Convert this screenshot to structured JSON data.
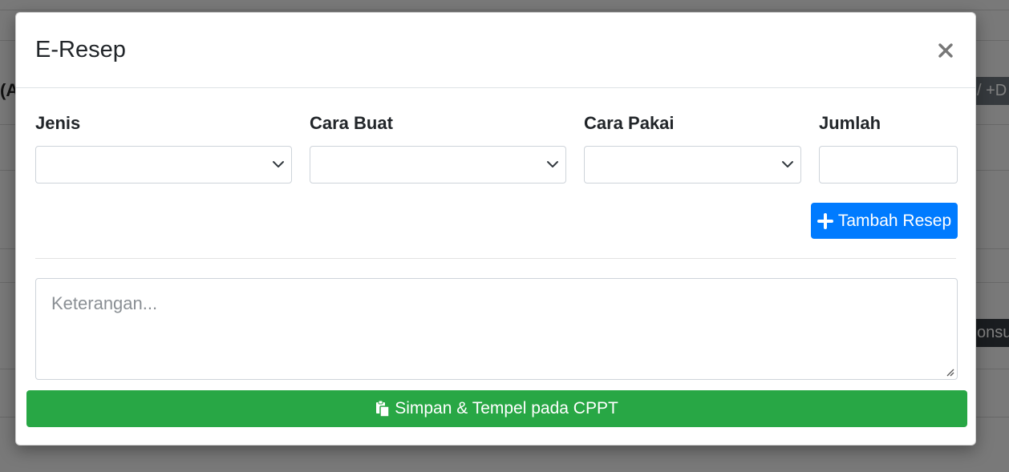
{
  "background": {
    "fragment_left": "(A",
    "fragment_right_top": "/ +D",
    "fragment_right_mid": "onsul"
  },
  "modal": {
    "title": "E-Resep",
    "close_icon": "close-icon"
  },
  "form": {
    "jenis_label": "Jenis",
    "cara_buat_label": "Cara Buat",
    "cara_pakai_label": "Cara Pakai",
    "jumlah_label": "Jumlah",
    "jenis_value": "",
    "cara_buat_value": "",
    "cara_pakai_value": "",
    "jumlah_value": ""
  },
  "actions": {
    "tambah_label": "Tambah Resep",
    "tambah_icon": "plus-icon",
    "keterangan_placeholder": "Keterangan...",
    "simpan_label": "Simpan & Tempel pada CPPT",
    "simpan_icon": "paste-icon"
  },
  "colors": {
    "primary": "#007bff",
    "success": "#28a745"
  }
}
